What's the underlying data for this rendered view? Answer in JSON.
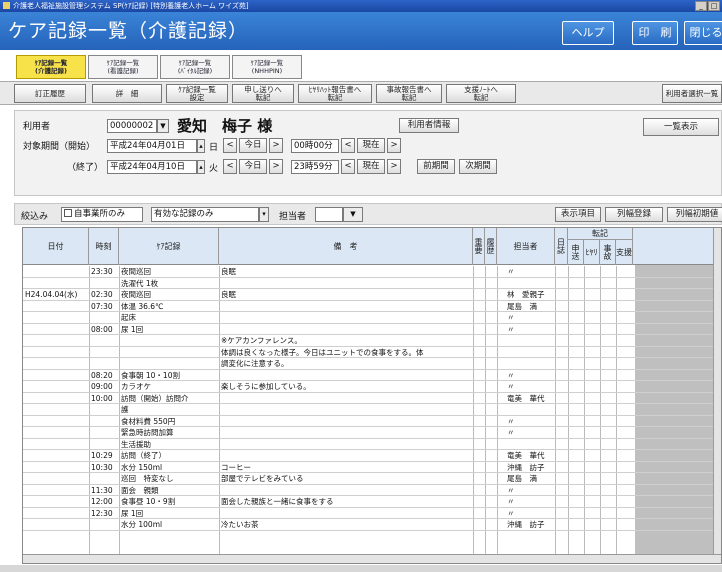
{
  "window": {
    "title": "介護老人福祉施設管理システム SP(ｹｱ記録) [特別養護老人ホーム ワイズ苑]",
    "controls": [
      "_",
      "□"
    ]
  },
  "header": {
    "title": "ケア記録一覧（介護記録）",
    "buttons": {
      "help": "ヘルプ",
      "print": "印　刷",
      "close": "閉じる"
    }
  },
  "tabs": [
    {
      "l1": "ｹｱ記録一覧",
      "l2": "(介護記録)",
      "active": true
    },
    {
      "l1": "ｹｱ記録一覧",
      "l2": "(看護記録)"
    },
    {
      "l1": "ｹｱ記録一覧",
      "l2": "(ﾊﾞｲﾀﾙ記録)"
    },
    {
      "l1": "ｹｱ記録一覧",
      "l2": "(NHHPIN)"
    }
  ],
  "toolbar": {
    "correction_history": "訂正履歴",
    "detail": "詳　細",
    "list_settings": "ｹｱ記録一覧\n設定",
    "handover": "申し送りへ\n転記",
    "hiyari": "ﾋﾔﾘﾊｯﾄ報告書へ\n転記",
    "accident": "事故報告書へ\n転記",
    "support_note": "支援ﾉｰﾄへ\n転記",
    "user_select": "利用者選択一覧"
  },
  "criteria": {
    "user_label": "利用者",
    "user_id": "00000002",
    "user_name": "愛知　梅子 様",
    "user_info_btn": "利用者情報",
    "list_display_btn": "一覧表示",
    "period_start_label": "対象期間（開始）",
    "start_date": "平成24年04月01日",
    "start_weekday": "日",
    "start_time": "00時00分",
    "period_end_label": "（終了）",
    "end_date": "平成24年04月10日",
    "end_weekday": "火",
    "end_time": "23時59分",
    "prev": "<",
    "today": "今日",
    "next": ">",
    "now": "現在",
    "prev_period": "前期間",
    "next_period": "次期間"
  },
  "filter": {
    "narrow_label": "絞込み",
    "own_office_only": "自事業所のみ",
    "record_filter": "有効な記録のみ",
    "staff_label": "担当者",
    "display_items": "表示項目",
    "col_width_register": "列幅登録",
    "col_width_init": "列幅初期値"
  },
  "columns": {
    "date": "日付",
    "time": "時刻",
    "care": "ｹｱ記録",
    "note": "備　考",
    "important": "重要",
    "history": "履歴",
    "staff": "担当者",
    "diary": "日誌",
    "transfer": "転記",
    "handover": "申送",
    "hiyari": "ﾋﾔﾘ",
    "accident": "事故",
    "support": "支援"
  },
  "rows": [
    {
      "date": "",
      "time": "23:30",
      "care": "夜間巡回",
      "note": "良眠",
      "staff": "〃"
    },
    {
      "date": "",
      "time": "",
      "care": "洗濯代 1枚",
      "note": "",
      "staff": ""
    },
    {
      "date": "H24.04.04(水)",
      "time": "02:30",
      "care": "夜間巡回",
      "note": "良眠",
      "staff": "林　愛親子"
    },
    {
      "date": "",
      "time": "07:30",
      "care": "体温 36.6℃",
      "note": "",
      "staff": "尾島　満"
    },
    {
      "date": "",
      "time": "",
      "care": "起床",
      "note": "",
      "staff": "〃"
    },
    {
      "date": "",
      "time": "08:00",
      "care": "尿 1回",
      "note": "",
      "staff": "〃"
    },
    {
      "date": "",
      "time": "",
      "care": "",
      "note": "※ケアカンファレンス。",
      "staff": ""
    },
    {
      "date": "",
      "time": "",
      "care": "",
      "note": "体調は良くなった様子。今日はユニットでの食事をする。体",
      "staff": ""
    },
    {
      "date": "",
      "time": "",
      "care": "",
      "note": "調変化に注意する。",
      "staff": ""
    },
    {
      "date": "",
      "time": "08:20",
      "care": "食事朝 10・10割",
      "note": "",
      "staff": "〃"
    },
    {
      "date": "",
      "time": "09:00",
      "care": "カラオケ",
      "note": "楽しそうに参加している。",
      "staff": "〃"
    },
    {
      "date": "",
      "time": "10:00",
      "care": "訪問（開始）訪問介",
      "note": "",
      "staff": "竜美　華代"
    },
    {
      "date": "",
      "time": "",
      "care": "護",
      "note": "",
      "staff": ""
    },
    {
      "date": "",
      "time": "",
      "care": "食材料費 550円",
      "note": "",
      "staff": "〃"
    },
    {
      "date": "",
      "time": "",
      "care": "緊急時訪問加算",
      "note": "",
      "staff": "〃"
    },
    {
      "date": "",
      "time": "",
      "care": "生活援助",
      "note": "",
      "staff": ""
    },
    {
      "date": "",
      "time": "10:29",
      "care": "訪問（終了）",
      "note": "",
      "staff": "竜美　華代"
    },
    {
      "date": "",
      "time": "10:30",
      "care": "水分 150ml",
      "note": "コーヒー",
      "staff": "沖縄　訪子"
    },
    {
      "date": "",
      "time": "",
      "care": "巡回　特変なし",
      "note": "部屋でテレビをみている",
      "staff": "尾島　満"
    },
    {
      "date": "",
      "time": "11:30",
      "care": "面会　親類",
      "note": "",
      "staff": "〃"
    },
    {
      "date": "",
      "time": "12:00",
      "care": "食事昼 10・9割",
      "note": "面会した親族と一緒に食事をする",
      "staff": "〃"
    },
    {
      "date": "",
      "time": "12:30",
      "care": "尿 1回",
      "note": "",
      "staff": "〃"
    },
    {
      "date": "",
      "time": "",
      "care": "水分 100ml",
      "note": "冷たいお茶",
      "staff": "沖縄　訪子"
    }
  ],
  "colors": {
    "header_bg": "#2563b9",
    "active_tab": "#f7e24a",
    "grid_header": "#dbe7f5"
  }
}
